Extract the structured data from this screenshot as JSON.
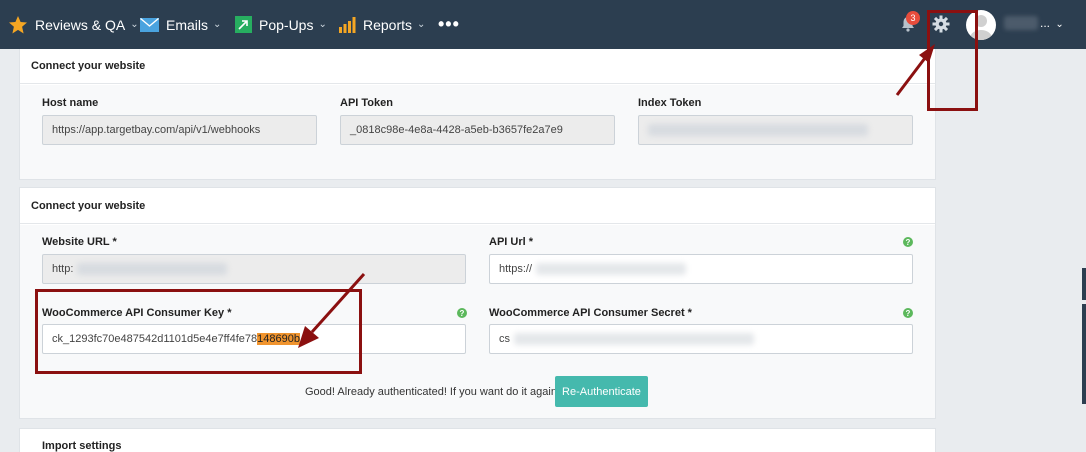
{
  "nav": {
    "items": [
      {
        "label": "Reviews & QA",
        "icon": "star-icon"
      },
      {
        "label": "Emails",
        "icon": "envelope-icon"
      },
      {
        "label": "Pop-Ups",
        "icon": "popup-icon"
      },
      {
        "label": "Reports",
        "icon": "bar-chart-icon"
      }
    ],
    "more": "•••",
    "notifications_count": "3",
    "user_menu": "..."
  },
  "card1": {
    "title": "Connect your website",
    "host_label": "Host name",
    "host_value": "https://app.targetbay.com/api/v1/webhooks",
    "api_token_label": "API Token",
    "api_token_value": "_0818c98e-4e8a-4428-a5eb-b3657fe2a7e9",
    "index_token_label": "Index Token"
  },
  "card2": {
    "title": "Connect your website",
    "website_url_label": "Website URL *",
    "website_url_value": "http:",
    "api_url_label": "API Url *",
    "api_url_value": "https://",
    "consumer_key_label": "WooCommerce API Consumer Key *",
    "consumer_key_prefix": "ck_1293fc70e487542d1101d5e4e7ff4fe78",
    "consumer_key_highlight": "148690b",
    "consumer_secret_label": "WooCommerce API Consumer Secret *",
    "consumer_secret_value": "cs",
    "help_glyph": "?",
    "status_text": "Good! Already authenticated! If you want do it again?",
    "reauth_label": "Re-Authenticate"
  },
  "card3": {
    "title": "Import settings"
  },
  "colors": {
    "topbar": "#2c3e50",
    "annotation": "#8b1010",
    "highlight": "#f0942e",
    "reauth": "#45b9ad",
    "help": "#5cb85c"
  }
}
